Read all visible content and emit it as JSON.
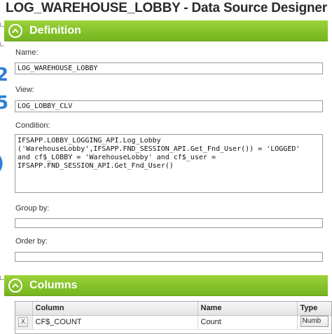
{
  "window": {
    "title": "LOG_WAREHOUSE_LOBBY - Data Source Designer"
  },
  "definition": {
    "header": "Definition",
    "name_label": "Name:",
    "name_value": "LOG_WAREHOUSE_LOBBY",
    "view_label": "View:",
    "view_value": "LOG_LOBBY_CLV",
    "condition_label": "Condition:",
    "condition_value": "IFSAPP.LOBBY_LOGGING_API.Log_Lobby\n('WarehouseLobby',IFSAPP.FND_SESSION_API.Get_Fnd_User()) = 'LOGGED'\nand cf$_LOBBY = 'WarehouseLobby' and cf$_user =\nIFSAPP.FND_SESSION_API.Get_Fnd_User()",
    "group_by_label": "Group by:",
    "group_by_value": "",
    "order_by_label": "Order by:",
    "order_by_value": ""
  },
  "columns": {
    "header": "Columns",
    "headers": [
      "Column",
      "Name",
      "Type"
    ],
    "rows": [
      {
        "delete": "X",
        "column": "CF$_COUNT",
        "name": "Count",
        "type": "Numb"
      }
    ]
  },
  "theme": {
    "header_green": "#84c12a",
    "edge_accent": "#2e7fd6"
  },
  "icons": {
    "section_toggle": "chevron-up-circle-icon",
    "row_delete": "close-icon"
  }
}
